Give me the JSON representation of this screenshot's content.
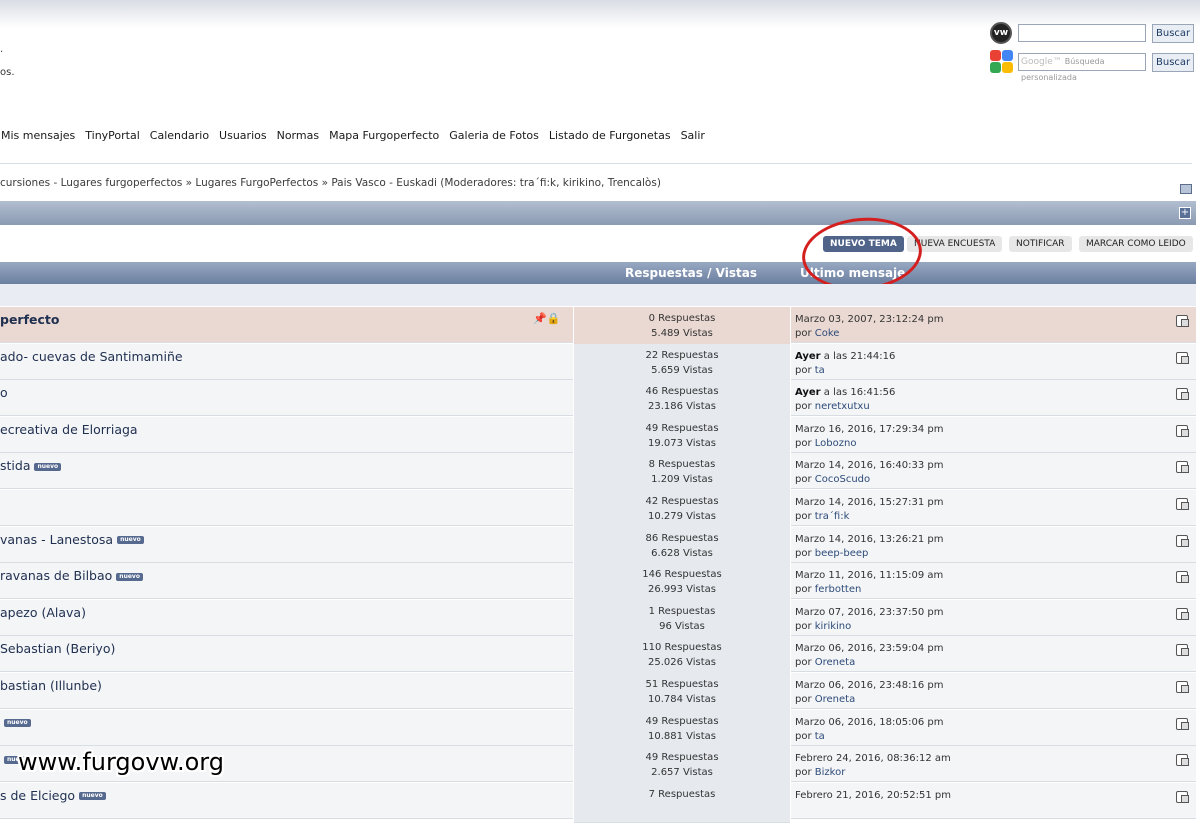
{
  "header": {
    "fragment_1": ".",
    "fragment_2": "os."
  },
  "search": {
    "site_button": "Buscar",
    "google_prefix": "Google™",
    "google_placeholder": "Búsqueda personalizada",
    "google_button": "Buscar"
  },
  "menu": [
    "Mis mensajes",
    "TinyPortal",
    "Calendario",
    "Usuarios",
    "Normas",
    "Mapa Furgoperfecto",
    "Galeria de Fotos",
    "Listado de Furgonetas",
    "Salir"
  ],
  "breadcrumb": "cursiones - Lugares furgoperfectos » Lugares FurgoPerfectos » Pais Vasco - Euskadi (Moderadores: tra´fi:k, kirikino, Trencalòs)",
  "buttons": {
    "nuevo_tema": "NUEVO TEMA",
    "nueva_encuesta": "NUEVA ENCUESTA",
    "notificar": "NOTIFICAR",
    "marcar": "MARCAR COMO LEIDO"
  },
  "table_header": {
    "replies_views": "Respuestas / Vistas",
    "last_post": "Último mensaje"
  },
  "badge_text": "nuevo",
  "topics": [
    {
      "title": "perfecto",
      "replies": "0 Respuestas",
      "views": "5.489 Vistas",
      "date_bold": "",
      "date": "Marzo 03, 2007, 23:12:24 pm",
      "author": "Coke",
      "sticky": true,
      "new": false
    },
    {
      "title": "ado- cuevas de Santimamiñe",
      "replies": "22 Respuestas",
      "views": "5.659 Vistas",
      "date_bold": "Ayer",
      "date": " a las 21:44:16",
      "author": "ta",
      "sticky": false,
      "new": false
    },
    {
      "title": "o",
      "replies": "46 Respuestas",
      "views": "23.186 Vistas",
      "date_bold": "Ayer",
      "date": " a las 16:41:56",
      "author": "neretxutxu",
      "sticky": false,
      "new": false
    },
    {
      "title": "ecreativa de Elorriaga",
      "replies": "49 Respuestas",
      "views": "19.073 Vistas",
      "date_bold": "",
      "date": "Marzo 16, 2016, 17:29:34 pm",
      "author": "Lobozno",
      "sticky": false,
      "new": false
    },
    {
      "title": "stida",
      "replies": "8 Respuestas",
      "views": "1.209 Vistas",
      "date_bold": "",
      "date": "Marzo 14, 2016, 16:40:33 pm",
      "author": "CocoScudo",
      "sticky": false,
      "new": true
    },
    {
      "title": "",
      "replies": "42 Respuestas",
      "views": "10.279 Vistas",
      "date_bold": "",
      "date": "Marzo 14, 2016, 15:27:31 pm",
      "author": "tra´fi:k",
      "sticky": false,
      "new": false
    },
    {
      "title": "vanas - Lanestosa",
      "replies": "86 Respuestas",
      "views": "6.628 Vistas",
      "date_bold": "",
      "date": "Marzo 14, 2016, 13:26:21 pm",
      "author": "beep-beep",
      "sticky": false,
      "new": true
    },
    {
      "title": "ravanas de Bilbao",
      "replies": "146 Respuestas",
      "views": "26.993 Vistas",
      "date_bold": "",
      "date": "Marzo 11, 2016, 11:15:09 am",
      "author": "ferbotten",
      "sticky": false,
      "new": true
    },
    {
      "title": "apezo (Alava)",
      "replies": "1 Respuestas",
      "views": "96 Vistas",
      "date_bold": "",
      "date": "Marzo 07, 2016, 23:37:50 pm",
      "author": "kirikino",
      "sticky": false,
      "new": false
    },
    {
      "title": "Sebastian (Beriyo)",
      "replies": "110 Respuestas",
      "views": "25.026 Vistas",
      "date_bold": "",
      "date": "Marzo 06, 2016, 23:59:04 pm",
      "author": "Oreneta",
      "sticky": false,
      "new": false
    },
    {
      "title": "bastian (Illunbe)",
      "replies": "51 Respuestas",
      "views": "10.784 Vistas",
      "date_bold": "",
      "date": "Marzo 06, 2016, 23:48:16 pm",
      "author": "Oreneta",
      "sticky": false,
      "new": false
    },
    {
      "title": "",
      "replies": "49 Respuestas",
      "views": "10.881 Vistas",
      "date_bold": "",
      "date": "Marzo 06, 2016, 18:05:06 pm",
      "author": "ta",
      "sticky": false,
      "new": true
    },
    {
      "title": "",
      "replies": "49 Respuestas",
      "views": "2.657 Vistas",
      "date_bold": "",
      "date": "Febrero 24, 2016, 08:36:12 am",
      "author": "Bizkor",
      "sticky": false,
      "new": true
    },
    {
      "title": "s de Elciego",
      "replies": "7 Respuestas",
      "views": "",
      "date_bold": "",
      "date": "Febrero 21, 2016, 20:52:51 pm",
      "author": "",
      "sticky": false,
      "new": true
    }
  ],
  "by_label": "por",
  "watermark": "www.furgovw.org"
}
